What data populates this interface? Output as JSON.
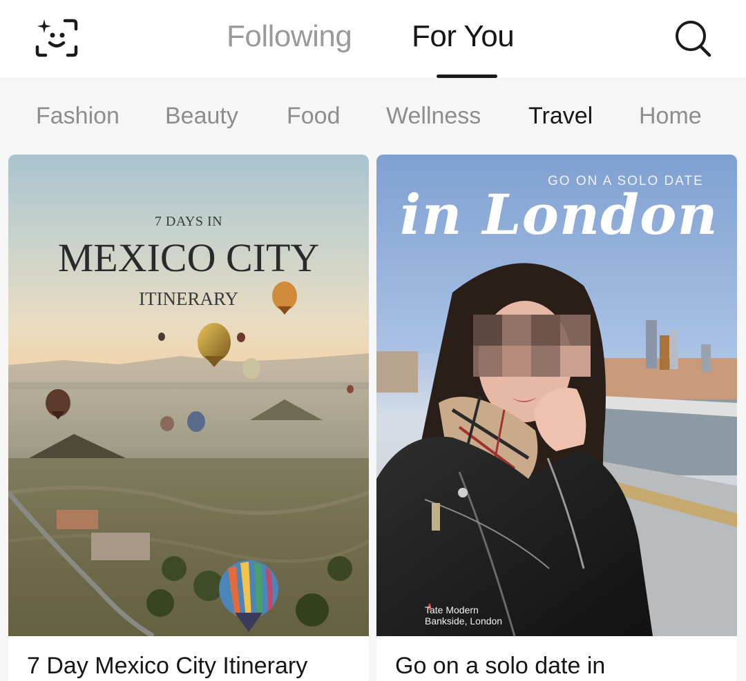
{
  "header": {
    "tabs": [
      {
        "label": "Following",
        "active": false
      },
      {
        "label": "For You",
        "active": true
      }
    ],
    "left_icon": "face-scan-sparkle-icon",
    "right_icon": "search-icon"
  },
  "categories": [
    {
      "label": "Fashion",
      "active": false
    },
    {
      "label": "Beauty",
      "active": false
    },
    {
      "label": "Food",
      "active": false
    },
    {
      "label": "Wellness",
      "active": false
    },
    {
      "label": "Travel",
      "active": true
    },
    {
      "label": "Home",
      "active": false
    }
  ],
  "feed": {
    "cards": [
      {
        "title": "7 Day Mexico City Itinerary",
        "image_kicker": "7 DAYS IN",
        "image_title": "MEXICO CITY",
        "image_subtitle": "ITINERARY"
      },
      {
        "title": "Go on a solo date in",
        "image_kicker": "GO ON A SOLO DATE",
        "image_title": "in London",
        "image_location_line1": "Tate Modern",
        "image_location_line2": "Bankside, London"
      }
    ]
  },
  "colors": {
    "active_text": "#161616",
    "inactive_text": "#8d8d8d",
    "strip_background": "#f6f6f6"
  }
}
